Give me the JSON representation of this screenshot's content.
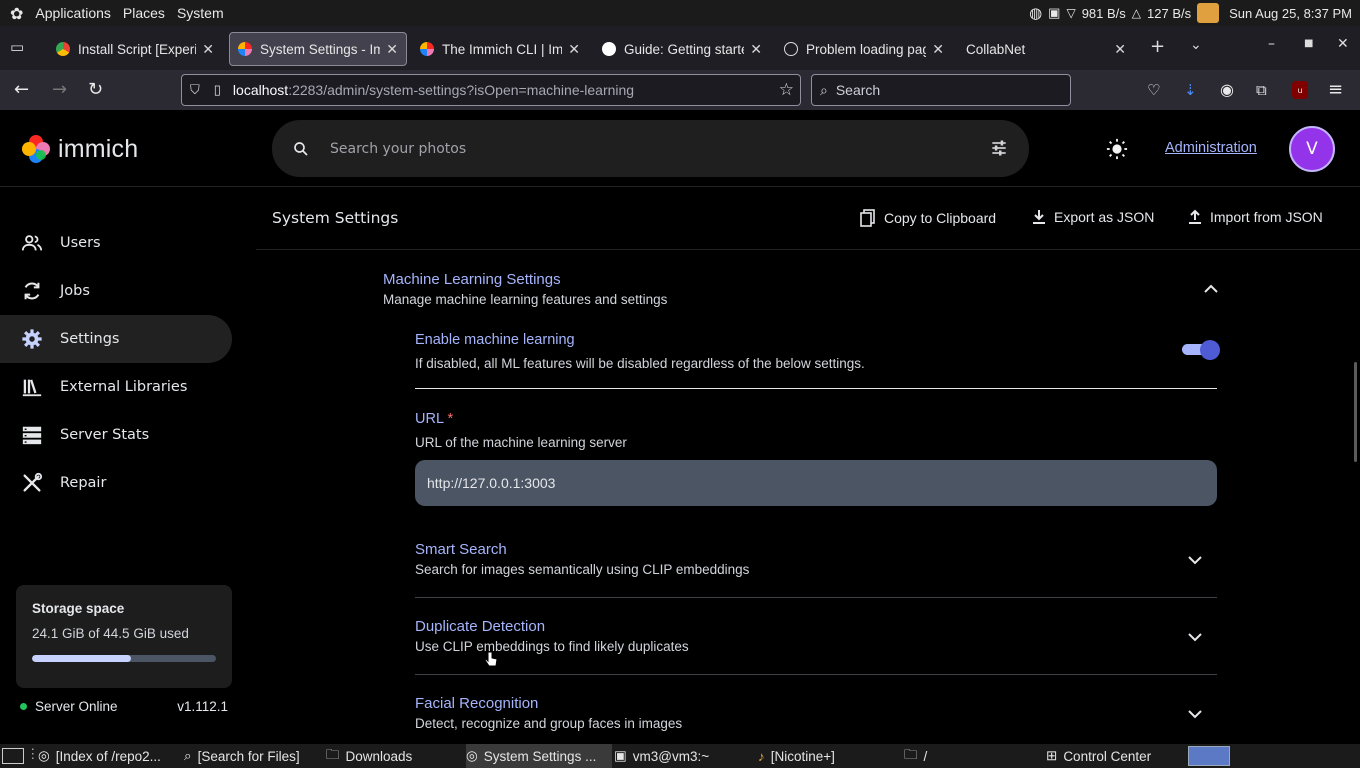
{
  "topbar": {
    "menus": [
      "Applications",
      "Places",
      "System"
    ],
    "net_down": "981 B/s",
    "net_up": "127 B/s",
    "clock": "Sun Aug 25,  8:37 PM"
  },
  "tabs": [
    {
      "title": "Install Script [Experimental]",
      "color": "#4285f4"
    },
    {
      "title": "System Settings - Immich",
      "color": "#fa2921"
    },
    {
      "title": "The Immich CLI | Immich",
      "color": "#fa2921"
    },
    {
      "title": "Guide: Getting started",
      "color": "#ffffff"
    },
    {
      "title": "Problem loading page",
      "color": "#ffffff"
    },
    {
      "title": "CollabNet",
      "color": ""
    }
  ],
  "browser": {
    "url_host": "localhost",
    "url_rest": ":2283/admin/system-settings?isOpen=machine-learning",
    "search_placeholder": "Search"
  },
  "app": {
    "logo_text": "immich",
    "search_placeholder": "Search your photos",
    "admin_link": "Administration",
    "avatar_letter": "V"
  },
  "sidebar": {
    "items": [
      {
        "label": "Users",
        "icon": "users-icon"
      },
      {
        "label": "Jobs",
        "icon": "sync-icon"
      },
      {
        "label": "Settings",
        "icon": "gear-icon"
      },
      {
        "label": "External Libraries",
        "icon": "library-icon"
      },
      {
        "label": "Server Stats",
        "icon": "server-icon"
      },
      {
        "label": "Repair",
        "icon": "tools-icon"
      }
    ],
    "active": "Settings",
    "storage_title": "Storage space",
    "storage_usage": "24.1 GiB of 44.5 GiB used",
    "storage_fraction": 0.54,
    "server_status": "Server Online",
    "version": "v1.112.1"
  },
  "page": {
    "title": "System Settings",
    "copy_label": "Copy to Clipboard",
    "export_label": "Export as JSON",
    "import_label": "Import from JSON"
  },
  "ml": {
    "title": "Machine Learning Settings",
    "subtitle": "Manage machine learning features and settings",
    "enable_label": "Enable machine learning",
    "enable_desc": "If disabled, all ML features will be disabled regardless of the below settings.",
    "enabled": true,
    "url_label": "URL",
    "url_required": "*",
    "url_desc": "URL of the machine learning server",
    "url_value": "http://127.0.0.1:3003",
    "subsections": [
      {
        "title": "Smart Search",
        "desc": "Search for images semantically using CLIP embeddings"
      },
      {
        "title": "Duplicate Detection",
        "desc": "Use CLIP embeddings to find likely duplicates"
      },
      {
        "title": "Facial Recognition",
        "desc": "Detect, recognize and group faces in images"
      }
    ]
  },
  "taskbar": {
    "items": [
      "[Index of /repo2...",
      "[Search for Files]",
      "Downloads",
      "System Settings ...",
      "vm3@vm3:~",
      "[Nicotine+]",
      "/",
      "Control Center"
    ]
  }
}
